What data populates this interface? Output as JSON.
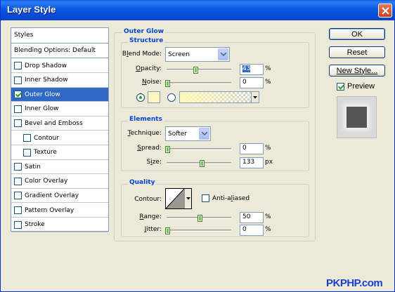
{
  "window": {
    "title": "Layer Style"
  },
  "styles_panel": {
    "header": "Styles",
    "blending": "Blending Options: Default",
    "items": [
      {
        "label": "Drop Shadow",
        "checked": false,
        "indent": false,
        "selected": false
      },
      {
        "label": "Inner Shadow",
        "checked": false,
        "indent": false,
        "selected": false
      },
      {
        "label": "Outer Glow",
        "checked": true,
        "indent": false,
        "selected": true
      },
      {
        "label": "Inner Glow",
        "checked": false,
        "indent": false,
        "selected": false
      },
      {
        "label": "Bevel and Emboss",
        "checked": false,
        "indent": false,
        "selected": false
      },
      {
        "label": "Contour",
        "checked": false,
        "indent": true,
        "selected": false
      },
      {
        "label": "Texture",
        "checked": false,
        "indent": true,
        "selected": false
      },
      {
        "label": "Satin",
        "checked": false,
        "indent": false,
        "selected": false
      },
      {
        "label": "Color Overlay",
        "checked": false,
        "indent": false,
        "selected": false
      },
      {
        "label": "Gradient Overlay",
        "checked": false,
        "indent": false,
        "selected": false
      },
      {
        "label": "Pattern Overlay",
        "checked": false,
        "indent": false,
        "selected": false
      },
      {
        "label": "Stroke",
        "checked": false,
        "indent": false,
        "selected": false
      }
    ]
  },
  "outer_glow": {
    "title": "Outer Glow",
    "structure": {
      "title": "Structure",
      "blend_mode": {
        "label_pre": "B",
        "label_u": "l",
        "label_post": "end Mode:",
        "value": "Screen"
      },
      "opacity": {
        "label_pre": "",
        "label_u": "O",
        "label_post": "pacity:",
        "value": "43",
        "unit": "%",
        "level": 43
      },
      "noise": {
        "label_pre": "",
        "label_u": "N",
        "label_post": "oise:",
        "value": "0",
        "unit": "%",
        "level": 0
      },
      "color_swatch": "#fff6c0",
      "gradient_from": "#fff8b8"
    },
    "elements": {
      "title": "Elements",
      "technique": {
        "label_pre": "",
        "label_u": "T",
        "label_post": "echnique:",
        "value": "Softer"
      },
      "spread": {
        "label_pre": "",
        "label_u": "S",
        "label_post": "pread:",
        "value": "0",
        "unit": "%",
        "level": 0
      },
      "size": {
        "label_pre": "S",
        "label_u": "i",
        "label_post": "ze:",
        "value": "133",
        "unit": "px",
        "level": 53
      }
    },
    "quality": {
      "title": "Quality",
      "contour_label": "Contour:",
      "anti_aliased": {
        "label_pre": "Anti-a",
        "label_u": "l",
        "label_post": "iased",
        "checked": false
      },
      "range": {
        "label_pre": "",
        "label_u": "R",
        "label_post": "ange:",
        "value": "50",
        "unit": "%",
        "level": 50
      },
      "jitter": {
        "label_pre": "",
        "label_u": "J",
        "label_post": "itter:",
        "value": "0",
        "unit": "%",
        "level": 0
      }
    }
  },
  "buttons": {
    "ok": "OK",
    "reset": "Reset",
    "new_style": "New Style...",
    "preview": "Preview",
    "preview_checked": true
  },
  "watermark": "PKPHP.com"
}
